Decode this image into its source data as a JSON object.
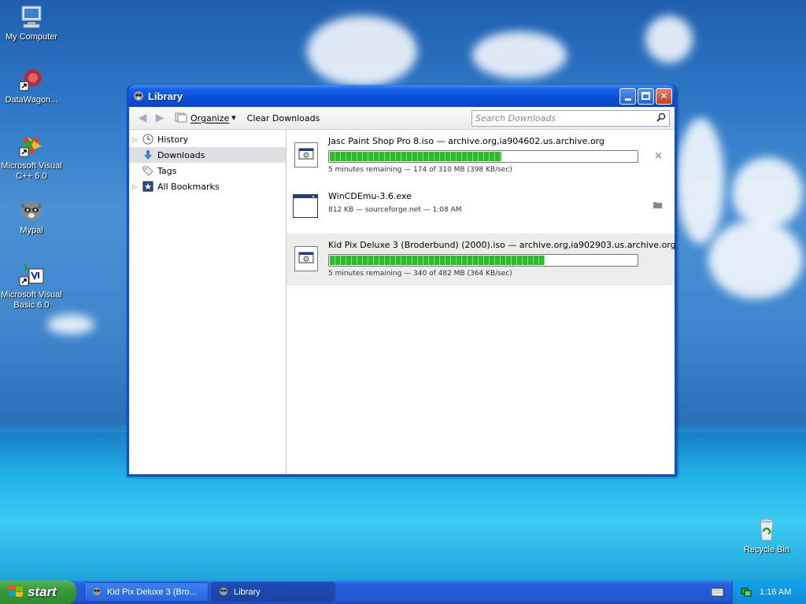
{
  "desktop": {
    "icons": [
      {
        "label": "My Computer",
        "icon": "computer-icon"
      },
      {
        "label": "DataWagon...",
        "icon": "shortcut-app-icon"
      },
      {
        "label": "Microsoft Visual C++ 6.0",
        "icon": "visual-cpp-icon"
      },
      {
        "label": "Mypal",
        "icon": "raccoon-icon"
      },
      {
        "label": "Microsoft Visual Basic 6.0",
        "icon": "visual-basic-icon"
      },
      {
        "label": "Recycle Bin",
        "icon": "recycle-bin-icon"
      }
    ]
  },
  "window": {
    "title": "Library",
    "toolbar": {
      "organize": "Organize",
      "clear_downloads": "Clear Downloads",
      "search_placeholder": "Search Downloads"
    },
    "sidebar": [
      {
        "label": "History",
        "icon": "clock-icon"
      },
      {
        "label": "Downloads",
        "icon": "download-arrow-icon"
      },
      {
        "label": "Tags",
        "icon": "tag-icon"
      },
      {
        "label": "All Bookmarks",
        "icon": "bookmarks-icon"
      }
    ],
    "downloads": [
      {
        "name": "Jasc Paint Shop Pro 8.iso — archive.org,ia904602.us.archive.org",
        "status": "5 minutes remaining — 174 of 310 MB (398 KB/sec)",
        "progress": 0.56,
        "action": "×"
      },
      {
        "name": "WinCDEmu-3.6.exe",
        "status": "812 KB — sourceforge.net — 1:08 AM"
      },
      {
        "name": "Kid Pix Deluxe 3 (Broderbund) (2000).iso — archive.org,ia902903.us.archive.org",
        "status": "5 minutes remaining — 340 of 482 MB (364 KB/sec)",
        "progress": 0.7
      }
    ]
  },
  "taskbar": {
    "start": "start",
    "tasks": [
      "Kid Pix Deluxe 3 (Bro...",
      "Library"
    ],
    "clock": "1:16 AM"
  }
}
